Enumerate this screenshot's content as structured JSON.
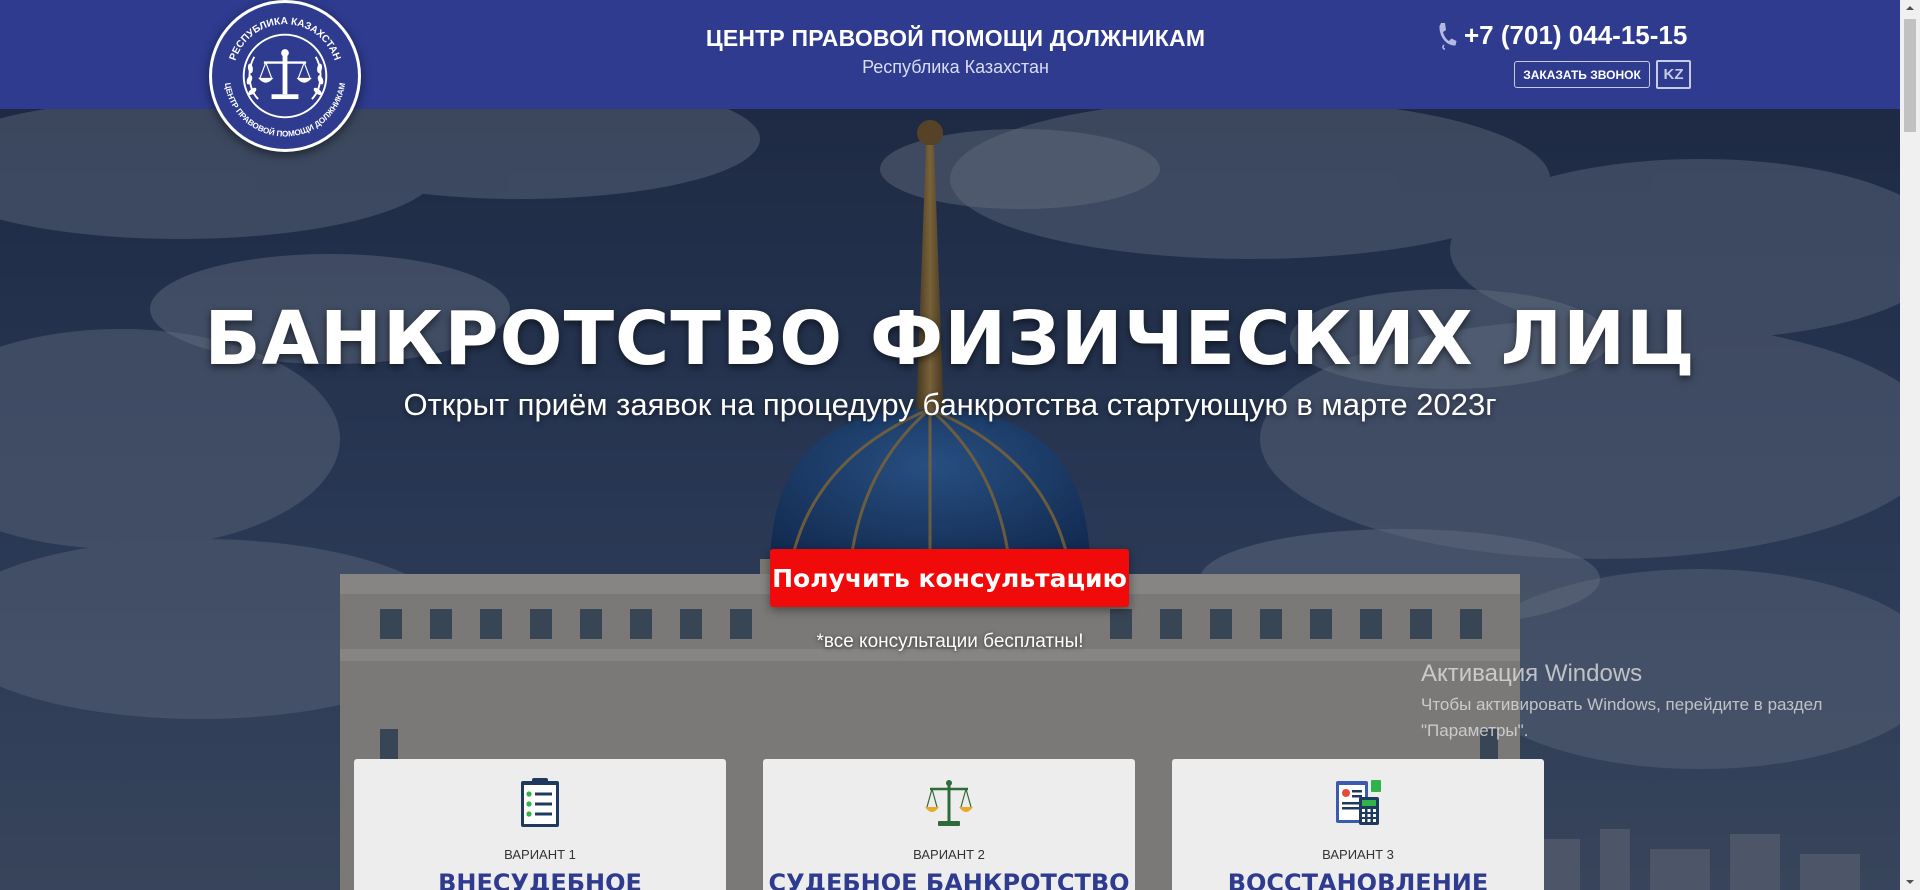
{
  "header": {
    "logo": {
      "top_text": "РЕСПУБЛИКА КАЗАХСТАН",
      "bottom_text": "ЦЕНТР ПРАВОВОЙ ПОМОЩИ ДОЛЖНИКАМ",
      "emblem": "scales-of-justice-icon"
    },
    "title": "ЦЕНТР ПРАВОВОЙ ПОМОЩИ ДОЛЖНИКАМ",
    "subtitle": "Республика Казахстан",
    "phone": "+7 (701) 044-15-15",
    "phone_icon": "phone-icon",
    "callback_label": "ЗАКАЗАТЬ ЗВОНОК",
    "lang_label": "KZ"
  },
  "hero": {
    "title": "БАНКРОТСТВО ФИЗИЧЕСКИХ ЛИЦ",
    "subtitle": "Открыт приём заявок на процедуру банкротства стартующую в марте 2023г",
    "cta_label": "Получить консультацию",
    "note": "*все консультации бесплатны!"
  },
  "variants": [
    {
      "label": "ВАРИАНТ 1",
      "title": "ВНЕСУДЕБНОЕ",
      "icon": "checklist-icon"
    },
    {
      "label": "ВАРИАНТ 2",
      "title": "СУДЕБНОЕ БАНКРОТСТВО",
      "icon": "scales-icon"
    },
    {
      "label": "ВАРИАНТ 3",
      "title": "ВОССТАНОВЛЕНИЕ",
      "icon": "finance-document-icon"
    }
  ],
  "watermark": {
    "title": "Активация Windows",
    "text": "Чтобы активировать Windows, перейдите в раздел \"Параметры\"."
  },
  "colors": {
    "header_bg": "#2e3b8f",
    "cta_bg": "#f10a0a",
    "card_bg": "#ededed",
    "card_title": "#2e3b8f"
  }
}
